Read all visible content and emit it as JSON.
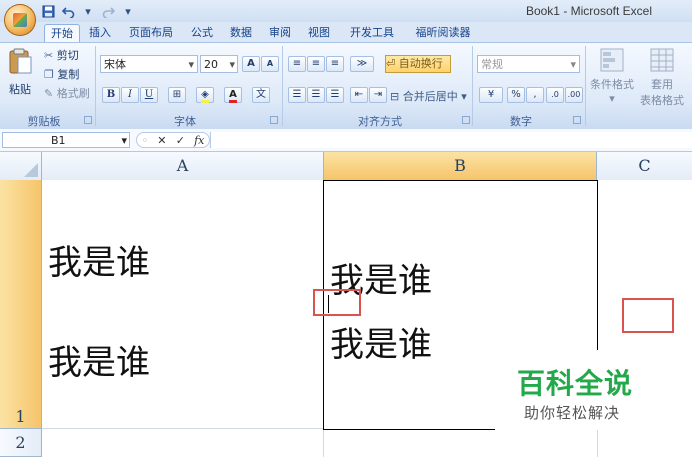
{
  "window": {
    "title": "Book1 - Microsoft Excel"
  },
  "quick_access": {
    "save_icon": "save-icon",
    "undo_icon": "undo-icon",
    "redo_icon": "redo-icon",
    "customize": "▾"
  },
  "tabs": [
    "开始",
    "插入",
    "页面布局",
    "公式",
    "数据",
    "审阅",
    "视图",
    "开发工具",
    "福昕阅读器"
  ],
  "active_tab": "开始",
  "ribbon": {
    "clipboard": {
      "paste": "粘贴",
      "cut": "剪切",
      "copy": "复制",
      "format_painter": "格式刷",
      "label": "剪贴板"
    },
    "font": {
      "name": "宋体",
      "size": "20",
      "bold": "B",
      "italic": "I",
      "underline": "U",
      "label": "字体",
      "grow": "A",
      "shrink": "A"
    },
    "alignment": {
      "wrap_text": "自动换行",
      "merge_center": "合并后居中",
      "label": "对齐方式"
    },
    "number": {
      "format": "常规",
      "percent": "%",
      "comma": ",",
      "inc_decimal": ".0",
      "dec_decimal": ".00",
      "label": "数字"
    },
    "styles": {
      "conditional": "条件格式",
      "table_format_1": "套用",
      "table_format_2": "表格格式"
    }
  },
  "formula_bar": {
    "name_box": "B1",
    "fx": "fx",
    "cancel": "✕",
    "enter": "✓",
    "value": ""
  },
  "columns": [
    "A",
    "B",
    "C"
  ],
  "selected_column": "B",
  "rows": [
    "1",
    "2"
  ],
  "selected_row": "1",
  "cells": {
    "A1_line1": "我是谁",
    "A1_line2": "我是谁",
    "B1_line1": "我是谁",
    "B1_line2": "我是谁"
  },
  "watermark": {
    "main": "百科全说",
    "sub": "助你轻松解决"
  },
  "colors": {
    "accent": "#f6c46a",
    "highlight_box": "#d9534f",
    "watermark_green": "#23a84a"
  }
}
